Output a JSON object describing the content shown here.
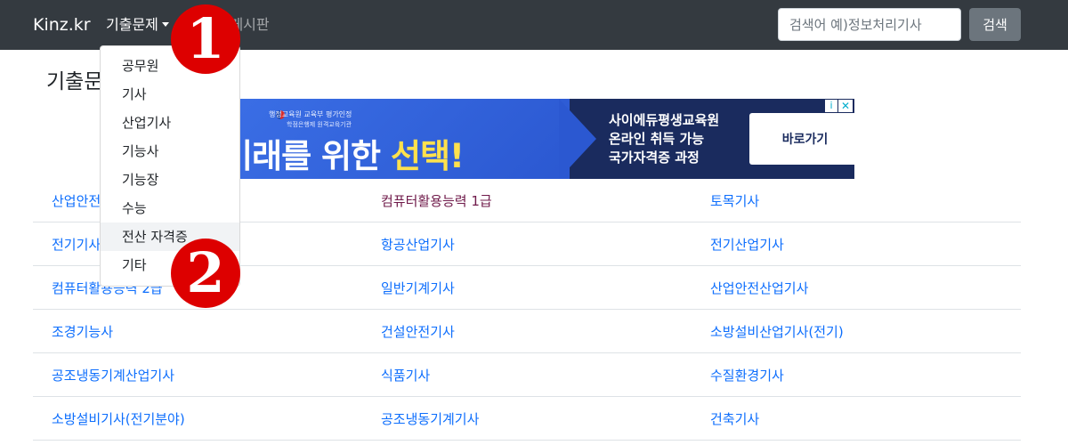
{
  "navbar": {
    "brand": "Kinz.kr",
    "dropdown_label": "기출문제",
    "board_label": "유머게시판",
    "search_placeholder": "검색어 예)정보처리기사",
    "search_button": "검색"
  },
  "dropdown": {
    "items": [
      "공무원",
      "기사",
      "산업기사",
      "기능사",
      "기능장",
      "수능",
      "전산 자격증",
      "기타"
    ]
  },
  "page": {
    "title": "기출문제"
  },
  "ad": {
    "logo_text": "행정교육원  교육부 평가인정",
    "logo_sub": "학점은행제 원격교육기관",
    "headline_main": "미래를 위한 ",
    "headline_highlight": "선택!",
    "right_line1": "사이에듀평생교육원",
    "right_line2": "온라인 취득 가능",
    "right_line3": "국가자격증 과정",
    "button": "바로가기",
    "info_icon": "i",
    "close_icon": "✕"
  },
  "list": {
    "rows": [
      [
        "산업안전기사",
        "컴퓨터활용능력 1급",
        "토목기사"
      ],
      [
        "전기기사",
        "항공산업기사",
        "전기산업기사"
      ],
      [
        "컴퓨터활용능력 2급",
        "일반기계기사",
        "산업안전산업기사"
      ],
      [
        "조경기능사",
        "건설안전기사",
        "소방설비산업기사(전기)"
      ],
      [
        "공조냉동기계산업기사",
        "식품기사",
        "수질환경기사"
      ],
      [
        "소방설비기사(전기분야)",
        "공조냉동기계기사",
        "건축기사"
      ]
    ]
  },
  "markers": [
    "1",
    "2"
  ],
  "colors": {
    "navbar": "#343a40",
    "link": "#0d6efd",
    "visited_link": "#6f1a4a",
    "marker": "#dd0000",
    "search_button": "#6c757d"
  }
}
